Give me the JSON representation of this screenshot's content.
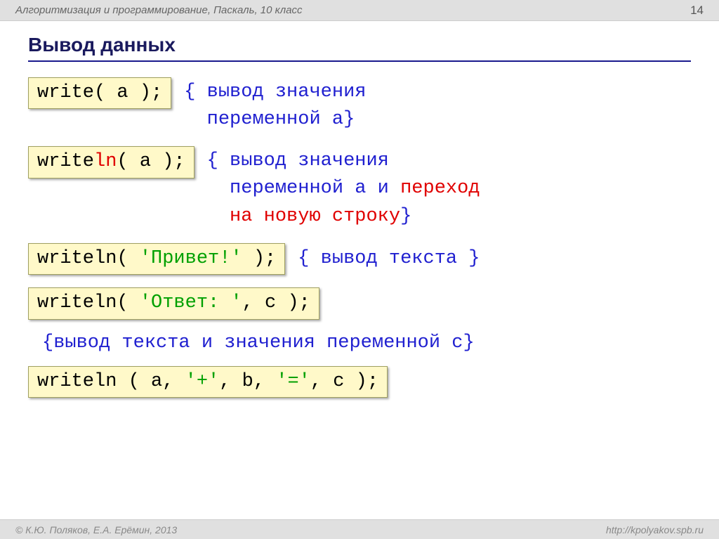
{
  "header": {
    "title": "Алгоритмизация и программирование, Паскаль, 10 класс",
    "page_number": "14"
  },
  "slide_title": "Вывод данных",
  "row1": {
    "code": "write( a );",
    "comment_l1": "{ вывод значения",
    "comment_l2": "  переменной a}"
  },
  "row2": {
    "code_prefix": "write",
    "code_ln": "ln",
    "code_suffix": "( a );",
    "comment_l1": "{ вывод значения",
    "comment_l2": "  переменной a и ",
    "comment_red1": "переход",
    "comment_l3": "  ",
    "comment_red2": "на новую строку",
    "comment_close": "}"
  },
  "row3": {
    "code_prefix": "writeln( ",
    "code_str": "'Привет!'",
    "code_suffix": " );",
    "comment": "{ вывод текста }"
  },
  "row4": {
    "code_prefix": "writeln( ",
    "code_str": "'Ответ: '",
    "code_suffix": ", c );"
  },
  "row5_comment": "{вывод текста и значения переменной c}",
  "row6": {
    "p1": "writeln ( a, ",
    "s1": "'+'",
    "p2": ", b, ",
    "s2": "'='",
    "p3": ", c );"
  },
  "footer": {
    "left": "© К.Ю. Поляков, Е.А. Ерёмин, 2013",
    "right": "http://kpolyakov.spb.ru"
  }
}
